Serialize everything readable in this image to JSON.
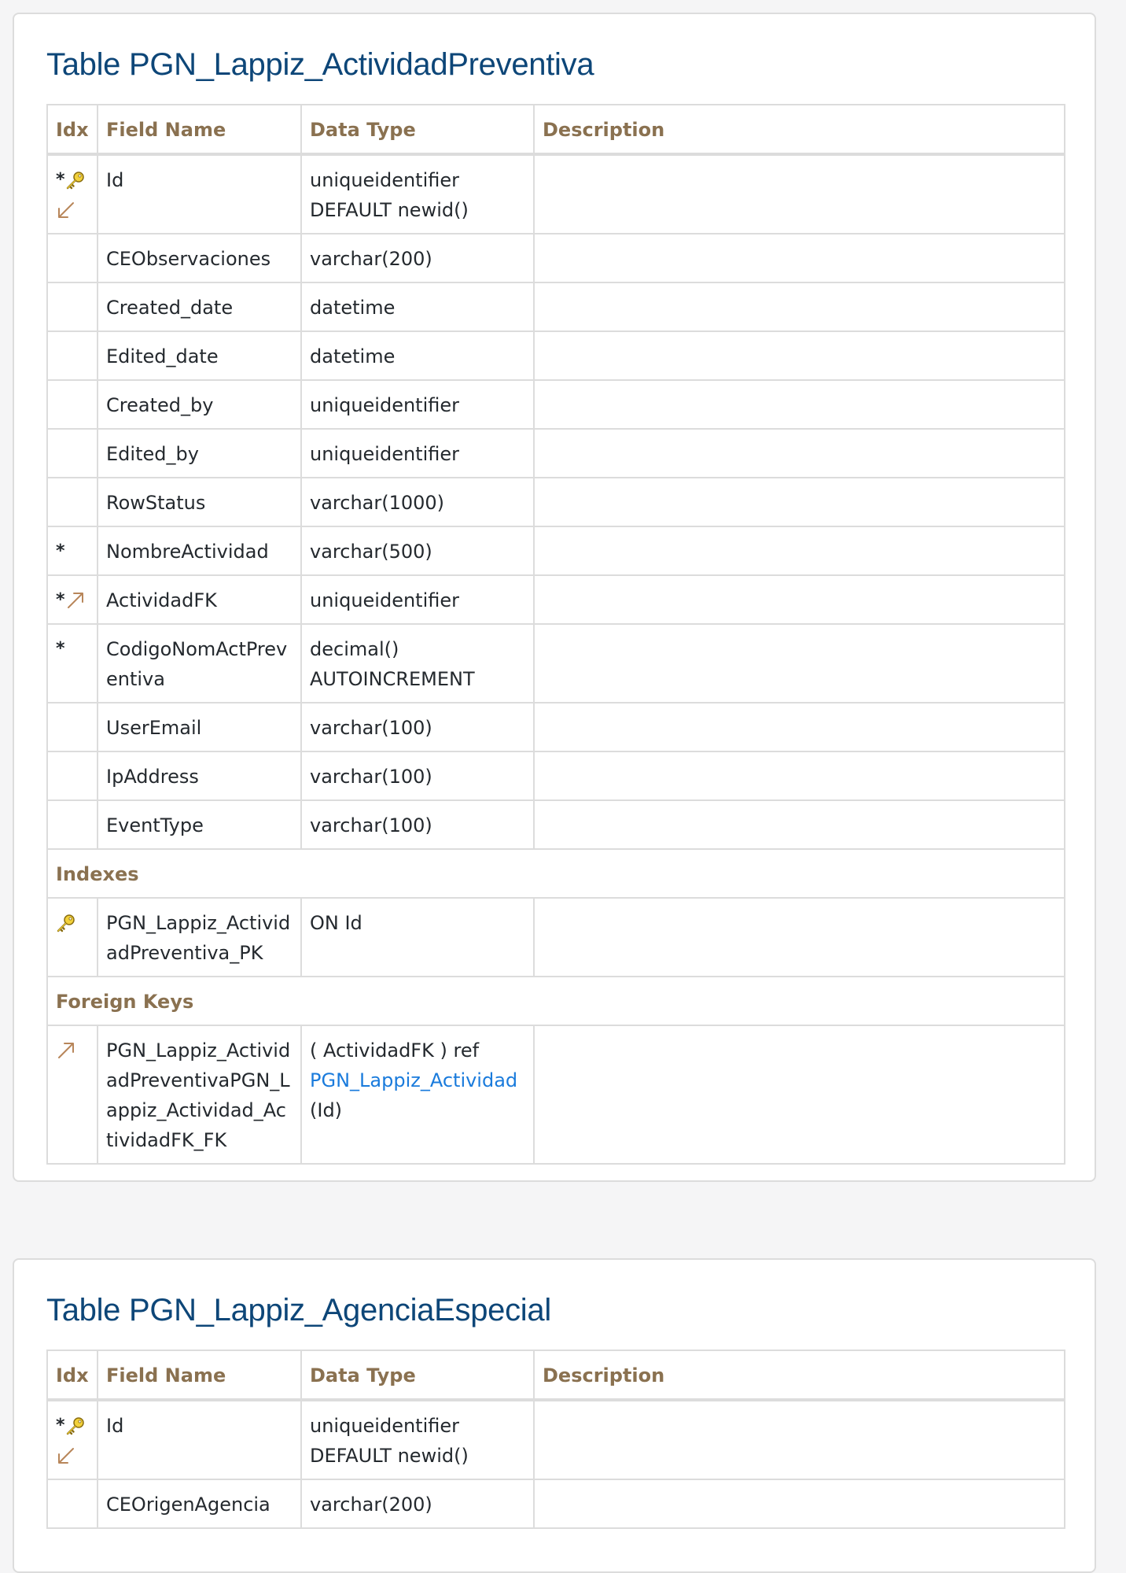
{
  "tables": [
    {
      "title": "Table PGN_Lappiz_ActividadPreventiva",
      "headers": {
        "idx": "Idx",
        "field": "Field Name",
        "type": "Data Type",
        "desc": "Description"
      },
      "fields": [
        {
          "markers": "*",
          "name": "Id",
          "type_line1": "uniqueidentifier",
          "type_line2": "DEFAULT newid()",
          "description": ""
        },
        {
          "markers": "",
          "name": "CEObservaciones",
          "type_line1": "varchar(200)",
          "description": ""
        },
        {
          "markers": "",
          "name": "Created_date",
          "type_line1": "datetime",
          "description": ""
        },
        {
          "markers": "",
          "name": "Edited_date",
          "type_line1": "datetime",
          "description": ""
        },
        {
          "markers": "",
          "name": "Created_by",
          "type_line1": "uniqueidentifier",
          "description": ""
        },
        {
          "markers": "",
          "name": "Edited_by",
          "type_line1": "uniqueidentifier",
          "description": ""
        },
        {
          "markers": "",
          "name": "RowStatus",
          "type_line1": "varchar(1000)",
          "description": ""
        },
        {
          "markers": "*",
          "name": "NombreActividad",
          "type_line1": "varchar(500)",
          "description": ""
        },
        {
          "markers": "*",
          "name": "ActividadFK",
          "type_line1": "uniqueidentifier",
          "description": ""
        },
        {
          "markers": "*",
          "name": "CodigoNomActPreventiva",
          "type_line1": "decimal()",
          "type_line2": "AUTOINCREMENT",
          "description": ""
        },
        {
          "markers": "",
          "name": "UserEmail",
          "type_line1": "varchar(100)",
          "description": ""
        },
        {
          "markers": "",
          "name": "IpAddress",
          "type_line1": "varchar(100)",
          "description": ""
        },
        {
          "markers": "",
          "name": "EventType",
          "type_line1": "varchar(100)",
          "description": ""
        }
      ],
      "indexes_label": "Indexes",
      "indexes": [
        {
          "icon": "key-icon",
          "name": "PGN_Lappiz_ActividadPreventiva_PK",
          "definition": "ON Id",
          "description": ""
        }
      ],
      "foreign_keys_label": "Foreign Keys",
      "foreign_keys": [
        {
          "icon": "foreign-key-arrow-icon",
          "name": "PGN_Lappiz_ActividadPreventivaPGN_Lappiz_Actividad_ActividadFK_FK",
          "def_prefix": "( ActividadFK ) ref",
          "def_link": "PGN_Lappiz_Actividad",
          "def_suffix": "(Id)",
          "description": ""
        }
      ]
    },
    {
      "title": "Table PGN_Lappiz_AgenciaEspecial",
      "headers": {
        "idx": "Idx",
        "field": "Field Name",
        "type": "Data Type",
        "desc": "Description"
      },
      "fields": [
        {
          "markers": "*",
          "name": "Id",
          "type_line1": "uniqueidentifier",
          "type_line2": "DEFAULT newid()",
          "description": ""
        },
        {
          "markers": "",
          "name": "CEOrigenAgencia",
          "type_line1": "varchar(200)",
          "description": ""
        }
      ]
    }
  ],
  "colors": {
    "title": "#0d4678",
    "header": "#8a7150",
    "link": "#1a7bdc",
    "key_icon": "#e6b800",
    "arrow_icon": "#b8865a"
  }
}
